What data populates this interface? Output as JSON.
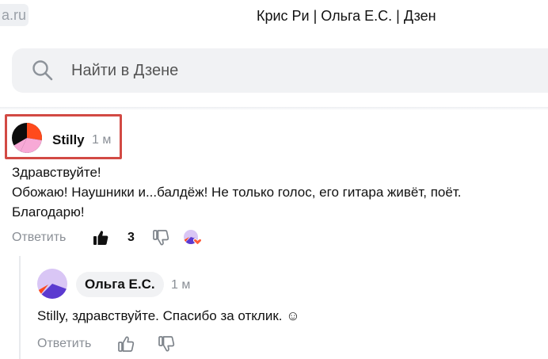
{
  "browser": {
    "url_fragment": "a.ru",
    "page_title": "Крис Ри | Ольга Е.С. | Дзен"
  },
  "search": {
    "placeholder": "Найти в Дзене"
  },
  "colors": {
    "highlight_border": "#d24a44",
    "muted_text": "#8a8f96",
    "search_bg": "#f1f2f4"
  },
  "comment": {
    "author": "Stilly",
    "time": "1 м",
    "lines": [
      "Здравствуйте!",
      "Обожаю! Наушники и...балдёж! Не только голос, его гитара живёт, поёт.",
      "Благодарю!"
    ],
    "reply_label": "Ответить",
    "like_count": "3",
    "icons": [
      "like-filled-icon",
      "dislike-icon",
      "author-heart-avatar-icon"
    ]
  },
  "reply": {
    "author": "Ольга Е.С.",
    "time": "1 м",
    "text": "Stilly, здравствуйте. Спасибо за отклик. ☺",
    "reply_label": "Ответить",
    "icons": [
      "like-icon",
      "dislike-icon"
    ]
  }
}
